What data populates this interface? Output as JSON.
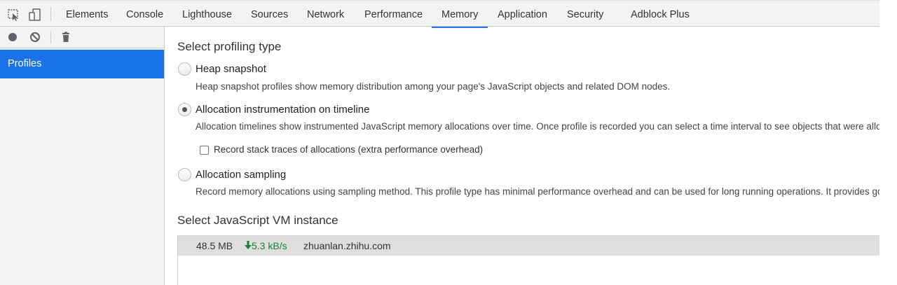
{
  "tabs": [
    {
      "label": "Elements"
    },
    {
      "label": "Console"
    },
    {
      "label": "Lighthouse"
    },
    {
      "label": "Sources"
    },
    {
      "label": "Network"
    },
    {
      "label": "Performance"
    },
    {
      "label": "Memory",
      "active": true
    },
    {
      "label": "Application"
    },
    {
      "label": "Security"
    },
    {
      "label": "Adblock Plus"
    }
  ],
  "toolbar_icons": [
    "inspect-element-icon",
    "device-toggle-icon",
    "record-icon",
    "clear-icon",
    "trash-icon"
  ],
  "sidebar": {
    "selected_item": "Profiles"
  },
  "profiling": {
    "heading": "Select profiling type",
    "options": [
      {
        "label": "Heap snapshot",
        "checked": false,
        "description": "Heap snapshot profiles show memory distribution among your page's JavaScript objects and related DOM nodes."
      },
      {
        "label": "Allocation instrumentation on timeline",
        "checked": true,
        "description": "Allocation timelines show instrumented JavaScript memory allocations over time. Once profile is recorded you can select a time interval to see objects that were allocated within it and still alive by the end of recording. Use this profile type to isolate memory leaks."
      },
      {
        "label": "Allocation sampling",
        "checked": false,
        "description": "Record memory allocations using sampling method. This profile type has minimal performance overhead and can be used for long running operations. It provides good approximation of allocations broken down by JavaScript execution stack."
      }
    ],
    "stack_traces_checkbox": {
      "label": "Record stack traces of allocations (extra performance overhead)",
      "checked": false
    }
  },
  "vm": {
    "heading": "Select JavaScript VM instance",
    "instances": [
      {
        "size": "48.5 MB",
        "rate": "5.3 kB/s",
        "url": "zhuanlan.zhihu.com"
      }
    ]
  },
  "colors": {
    "accent": "#1a73e8",
    "rate_green": "#188038"
  }
}
